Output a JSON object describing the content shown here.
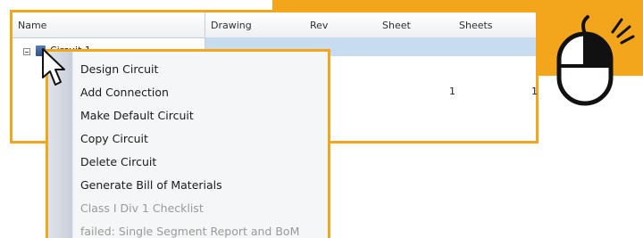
{
  "grid": {
    "columns": {
      "name": "Name",
      "drawing": "Drawing",
      "rev": "Rev",
      "sheet": "Sheet",
      "sheets": "Sheets"
    },
    "tree_node": "Circuit 1",
    "row_values": {
      "sheet": "1",
      "sheets": "1"
    }
  },
  "context_menu": {
    "items": [
      {
        "label": "Design Circuit",
        "enabled": true
      },
      {
        "label": "Add Connection",
        "enabled": true
      },
      {
        "label": "Make Default Circuit",
        "enabled": true
      },
      {
        "label": "Copy Circuit",
        "enabled": true
      },
      {
        "label": "Delete Circuit",
        "enabled": true
      },
      {
        "label": "Generate Bill of Materials",
        "enabled": true
      },
      {
        "label": "Class I Div 1 Checklist",
        "enabled": false
      },
      {
        "label": "failed: Single Segment Report and BoM",
        "enabled": false
      }
    ]
  },
  "colors": {
    "accent": "#f3a51c",
    "selection": "#c8dcf0",
    "menu_background": "#f5f6f7",
    "disabled_text": "#9a9a9a"
  },
  "icons": {
    "tree_expander": "collapse-icon",
    "tree_node": "circuit-icon",
    "pointer": "mouse-pointer-icon",
    "right_click_hint": "mouse-right-click-icon"
  }
}
